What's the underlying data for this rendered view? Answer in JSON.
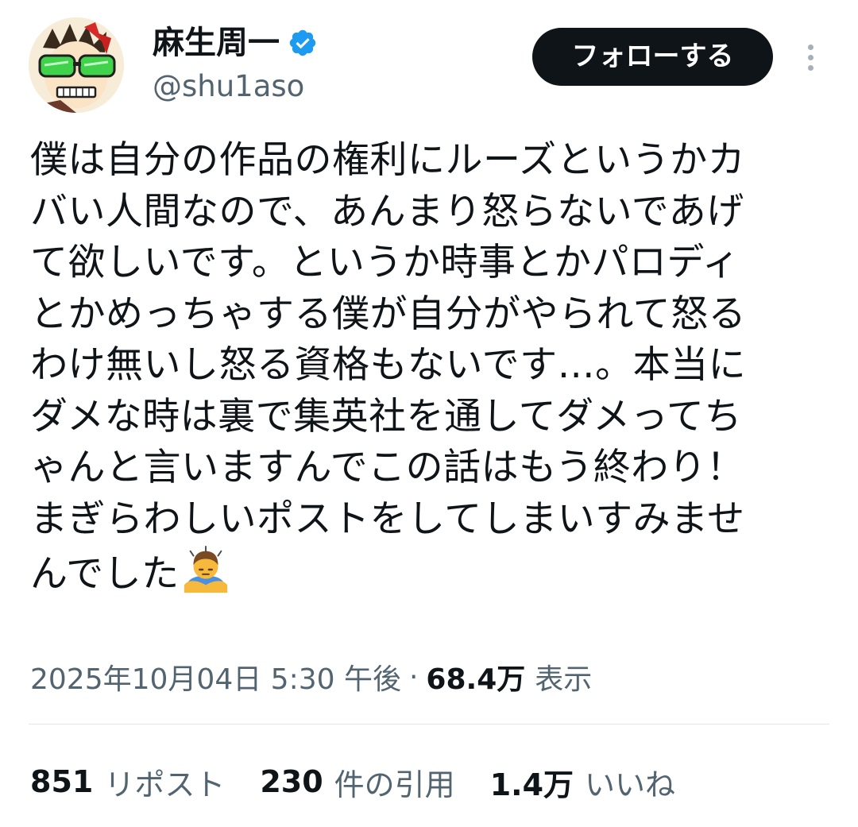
{
  "author": {
    "display_name": "麻生周一",
    "handle": "@shu1aso",
    "verified_icon": "verified-badge-icon",
    "verified_color": "#1d9bf0"
  },
  "follow_button": {
    "label": "フォローする"
  },
  "more_icon": "more-vertical-icon",
  "tweet": {
    "lines": [
      "僕は自分の作品の権利にルーズというかカ",
      "バい人間なので、あんまり怒らないであげ",
      "て欲しいです。というか時事とかパロディ",
      "とかめっちゃする僕が自分がやられて怒る",
      "わけ無いし怒る資格もないです…。本当に",
      "ダメな時は裏で集英社を通してダメってち",
      "ゃんと言いますんでこの話はもう終わり！",
      "まぎらわしいポストをしてしまいすみませ",
      "んでした"
    ],
    "emoji": "person-bowing-emoji-icon"
  },
  "meta": {
    "timestamp": "2025年10月04日 5:30 午後",
    "separator": "·",
    "views_count": "68.4万",
    "views_label": "表示"
  },
  "stats": {
    "reposts_count": "851",
    "reposts_label": "リポスト",
    "quotes_count": "230",
    "quotes_label": "件の引用",
    "likes_count": "1.4万",
    "likes_label": "いいね"
  },
  "colors": {
    "text_primary": "#0f1419",
    "text_secondary": "#536471",
    "button_bg": "#0f1419",
    "divider": "#e1e6ea"
  }
}
